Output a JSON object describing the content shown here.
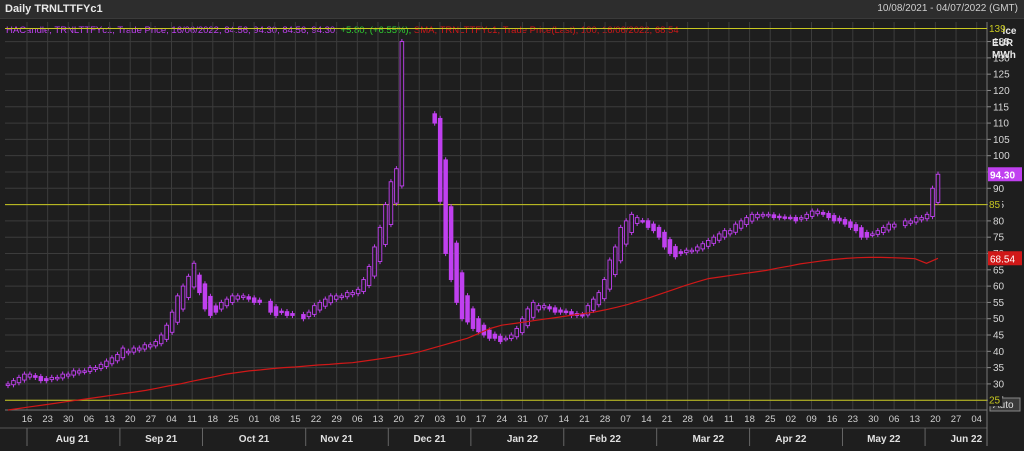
{
  "header": {
    "title": "Daily TRNLTTFYc1",
    "date_range": "10/08/2021 - 04/07/2022 (GMT)"
  },
  "legend": {
    "candle_label": "HACandle, TRNLTTFYc1, Trade Price, 16/06/2022, 84.56, 94.30, 84.56, 94.30,",
    "candle_change": "+5.80, (+6.55%),",
    "sma_label": "SMA, TRNLTTFYc1, Trade Price(Last), 100, 16/06/2022, 68.54"
  },
  "axis": {
    "unit_line1": "Price",
    "unit_line2": "EUR",
    "unit_line3": "MWh",
    "auto_label": "Auto"
  },
  "colors": {
    "background": "#1e1e1e",
    "grid": "#3c3c3c",
    "candle": "#c040f0",
    "sma": "#d01818",
    "hline": "#c8c820",
    "change_positive": "#30d030"
  },
  "chart_data": {
    "type": "candlestick",
    "y_range": [
      22,
      141
    ],
    "y_ticks": [
      25,
      30,
      35,
      40,
      45,
      50,
      55,
      60,
      65,
      70,
      75,
      80,
      85,
      90,
      95,
      100,
      105,
      110,
      115,
      120,
      125,
      130,
      135
    ],
    "horizontal_lines": [
      139,
      85,
      25
    ],
    "price_tags": {
      "last": "94.30",
      "sma": "68.54"
    },
    "x_ticks": [
      "16",
      "23",
      "30",
      "06",
      "13",
      "20",
      "27",
      "04",
      "11",
      "18",
      "25",
      "01",
      "08",
      "15",
      "22",
      "29",
      "06",
      "13",
      "20",
      "27",
      "03",
      "10",
      "17",
      "24",
      "31",
      "07",
      "14",
      "21",
      "28",
      "07",
      "14",
      "21",
      "28",
      "04",
      "11",
      "18",
      "25",
      "02",
      "09",
      "16",
      "23",
      "30",
      "06",
      "13",
      "20",
      "27",
      "04"
    ],
    "months": [
      "Aug 21",
      "Sep 21",
      "Oct 21",
      "Nov 21",
      "Dec 21",
      "Jan 22",
      "Feb 22",
      "Mar 22",
      "Apr 22",
      "May 22",
      "Jun 22"
    ],
    "series": {
      "close": [
        30,
        31,
        32,
        33,
        33,
        32,
        31,
        31,
        32,
        32,
        33,
        33,
        34,
        34,
        34,
        35,
        35,
        36,
        37,
        38,
        39,
        41,
        40,
        41,
        41,
        42,
        42,
        43,
        45,
        48,
        52,
        57,
        60,
        63,
        67,
        58,
        53,
        51,
        52,
        55,
        56,
        57,
        57,
        57,
        56,
        55,
        55,
        null,
        52,
        51,
        52,
        51,
        51,
        null,
        50,
        52,
        54,
        55,
        56,
        57,
        57,
        57,
        58,
        58,
        59,
        62,
        66,
        72,
        78,
        85,
        92,
        96,
        135,
        null,
        null,
        null,
        null,
        null,
        110,
        86,
        70,
        62,
        55,
        50,
        49,
        47,
        46,
        45,
        44,
        44,
        43,
        44,
        45,
        47,
        50,
        53,
        55,
        54,
        54,
        53,
        52,
        52,
        52,
        51,
        51,
        51,
        54,
        56,
        58,
        62,
        68,
        72,
        78,
        80,
        82,
        81,
        80,
        78,
        77,
        75,
        72,
        70,
        69,
        70,
        71,
        71,
        72,
        73,
        74,
        75,
        76,
        77,
        77,
        79,
        80,
        81,
        82,
        82,
        82,
        82,
        81,
        81,
        81,
        81,
        80,
        81,
        82,
        83,
        83,
        82,
        81,
        80,
        80,
        79,
        78,
        77,
        75,
        75,
        76,
        77,
        78,
        79,
        79,
        null,
        80,
        80,
        81,
        81,
        82,
        90,
        94.3
      ],
      "sma": [
        22,
        22.5,
        23,
        23.5,
        24,
        24.5,
        25,
        25.5,
        26,
        26.5,
        27,
        27.5,
        28,
        28.7,
        29.4,
        30,
        30.8,
        31.5,
        32.2,
        33,
        33.5,
        34,
        34.3,
        34.7,
        35,
        35.2,
        35.5,
        35.8,
        36,
        36.3,
        36.5,
        37,
        37.5,
        38,
        38.6,
        39.2,
        40,
        41,
        42,
        43,
        44,
        45.5,
        47,
        48,
        48.5,
        49,
        49.5,
        50,
        50.5,
        51,
        51.5,
        52,
        52.7,
        53.5,
        54.4,
        55.5,
        56.6,
        57.8,
        59,
        60.2,
        61.3,
        62.3,
        62.8,
        63.3,
        63.8,
        64.3,
        64.8,
        65.5,
        66.1,
        66.8,
        67.3,
        67.8,
        68.2,
        68.5,
        68.7,
        68.8,
        68.8,
        68.7,
        68.6,
        68.4,
        67,
        68.54
      ]
    }
  }
}
